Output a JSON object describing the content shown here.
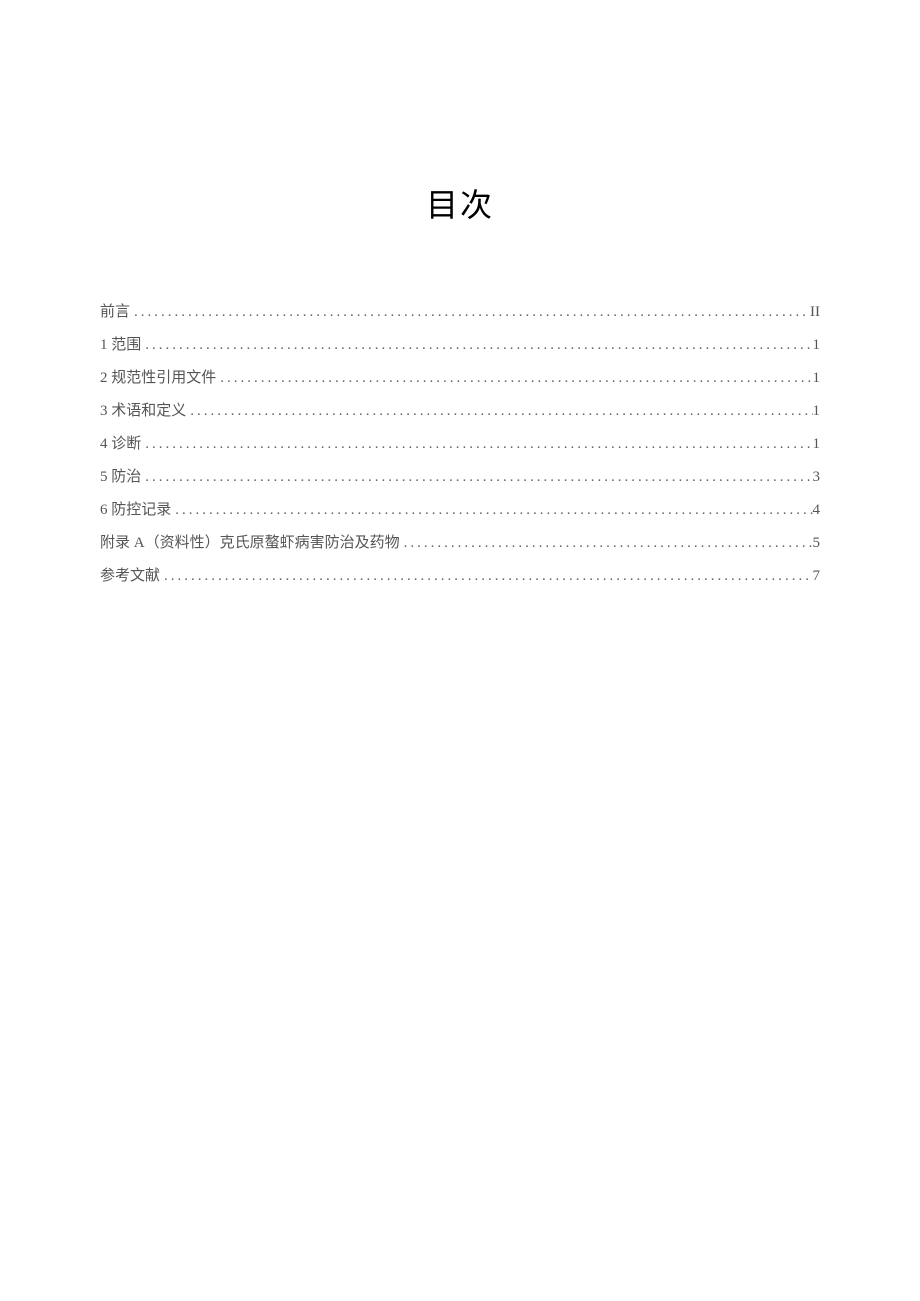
{
  "title": "目次",
  "toc": [
    {
      "label": "前言",
      "page": "II"
    },
    {
      "label": "1 范围",
      "page": "1"
    },
    {
      "label": "2 规范性引用文件",
      "page": "1"
    },
    {
      "label": "3 术语和定义",
      "page": "1"
    },
    {
      "label": "4 诊断",
      "page": "1"
    },
    {
      "label": "5 防治",
      "page": "3"
    },
    {
      "label": "6 防控记录",
      "page": "4"
    },
    {
      "label": "附录 A（资料性）克氏原螯虾病害防治及药物",
      "page": "5"
    },
    {
      "label": "参考文献",
      "page": "7"
    }
  ]
}
